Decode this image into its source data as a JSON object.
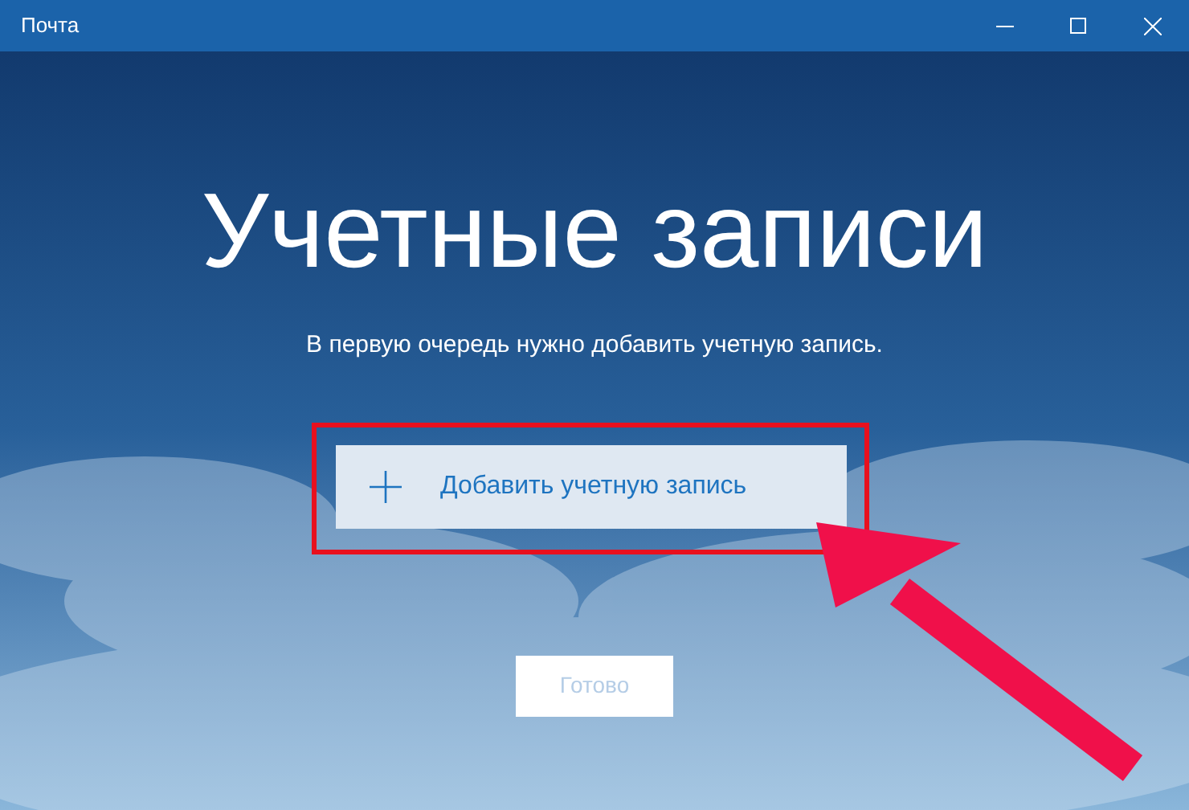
{
  "window": {
    "title": "Почта"
  },
  "heading": "Учетные записи",
  "subtitle": "В первую очередь нужно добавить учетную запись.",
  "add_account_button": {
    "label": "Добавить учетную запись"
  },
  "done_button": {
    "label": "Готово",
    "disabled": true
  },
  "annotations": [
    {
      "kind": "highlight"
    },
    {
      "kind": "arrow"
    }
  ]
}
